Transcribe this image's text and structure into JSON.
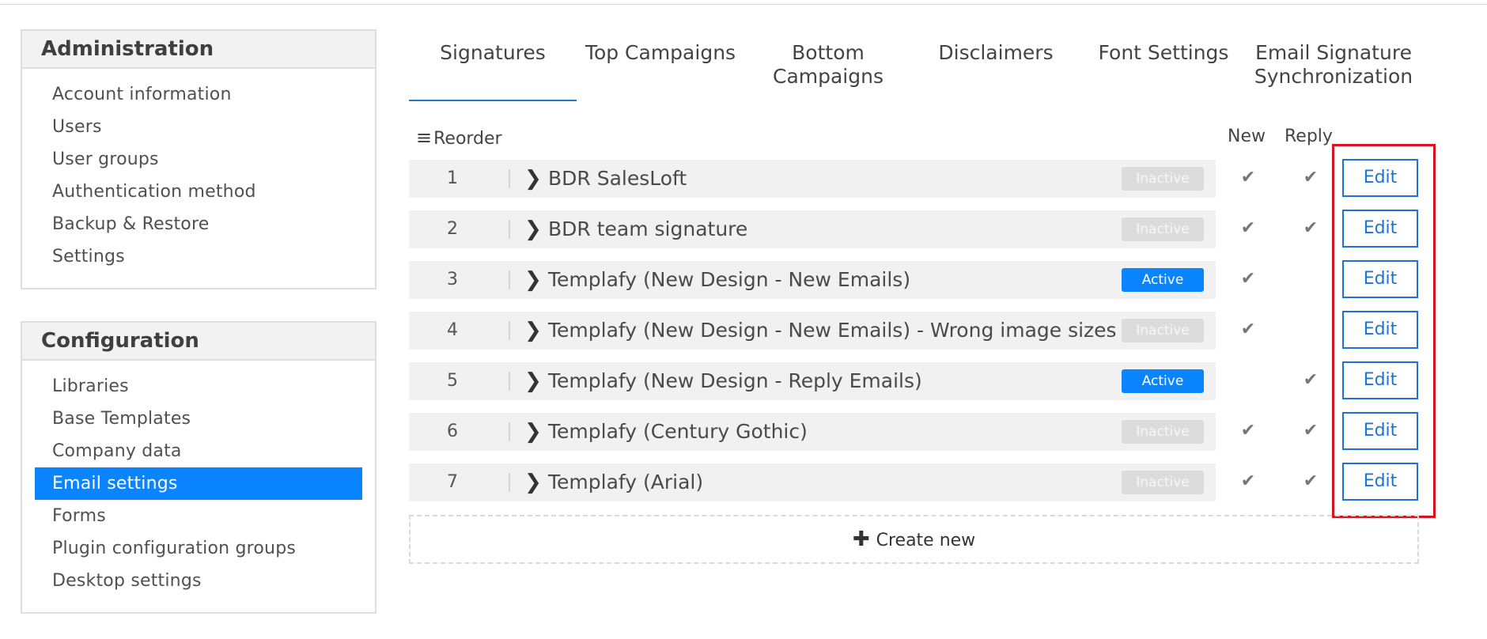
{
  "sidebar": {
    "administration": {
      "title": "Administration",
      "items": [
        "Account information",
        "Users",
        "User groups",
        "Authentication method",
        "Backup & Restore",
        "Settings"
      ]
    },
    "configuration": {
      "title": "Configuration",
      "items": [
        "Libraries",
        "Base Templates",
        "Company data",
        "Email settings",
        "Forms",
        "Plugin configuration groups",
        "Desktop settings"
      ],
      "active_index": 3
    }
  },
  "tabs": [
    {
      "label": "Signatures",
      "line2": ""
    },
    {
      "label": "Top Campaigns",
      "line2": ""
    },
    {
      "label": "Bottom",
      "line2": "Campaigns"
    },
    {
      "label": "Disclaimers",
      "line2": ""
    },
    {
      "label": "Font Settings",
      "line2": ""
    },
    {
      "label": "Email Signature",
      "line2": "Synchronization"
    }
  ],
  "table": {
    "reorder_label": "Reorder",
    "reorder_icon": "≡",
    "col_new": "New",
    "col_reply": "Reply",
    "check_glyph": "✔",
    "chevron_glyph": "❯",
    "edit_label": "Edit",
    "rows": [
      {
        "num": "1",
        "name": "BDR SalesLoft",
        "status": "Inactive",
        "new": true,
        "reply": true
      },
      {
        "num": "2",
        "name": "BDR team signature",
        "status": "Inactive",
        "new": true,
        "reply": true
      },
      {
        "num": "3",
        "name": "Templafy (New Design - New Emails)",
        "status": "Active",
        "new": true,
        "reply": false
      },
      {
        "num": "4",
        "name": "Templafy (New Design - New Emails) - Wrong image sizes",
        "status": "Inactive",
        "new": true,
        "reply": false
      },
      {
        "num": "5",
        "name": "Templafy (New Design - Reply Emails)",
        "status": "Active",
        "new": false,
        "reply": true
      },
      {
        "num": "6",
        "name": "Templafy (Century Gothic)",
        "status": "Inactive",
        "new": true,
        "reply": true
      },
      {
        "num": "7",
        "name": "Templafy (Arial)",
        "status": "Inactive",
        "new": true,
        "reply": true
      }
    ],
    "create_new_label": "Create new",
    "create_new_icon": "✚"
  },
  "colors": {
    "accent": "#0a84ff",
    "edit_border": "#1a73d9",
    "highlight": "#d8121e",
    "inactive_badge": "#dcdcdc"
  }
}
